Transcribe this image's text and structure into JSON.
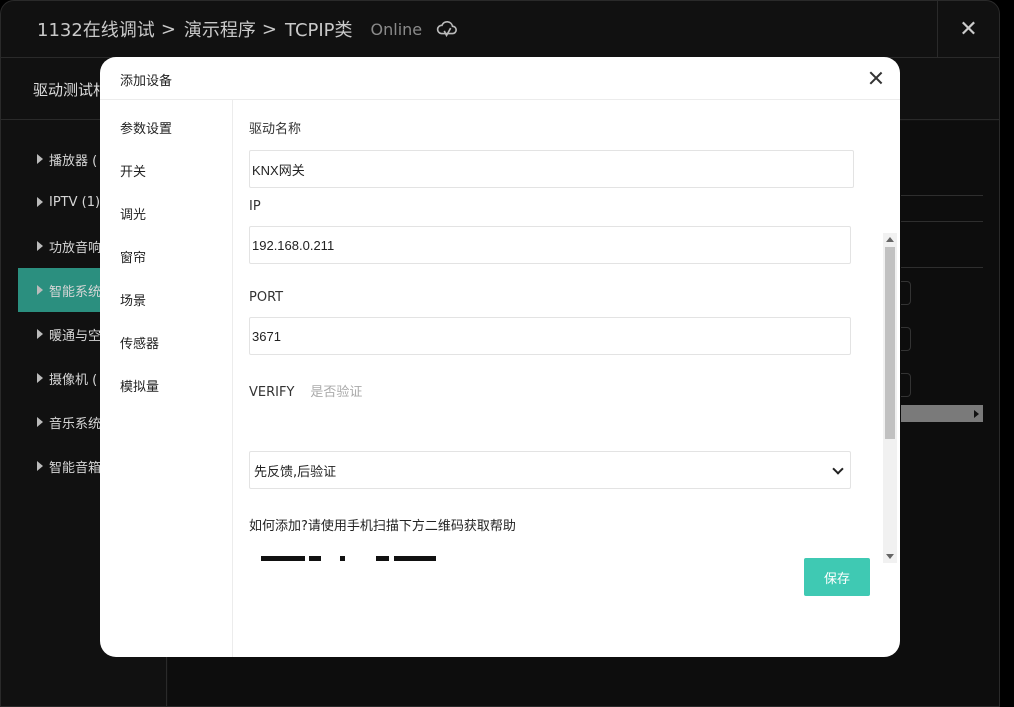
{
  "app": {
    "breadcrumbs": [
      "1132在线调试",
      "演示程序",
      "TCPIP类"
    ],
    "status": "Online",
    "sub_title": "驱动测试相",
    "sidebar": [
      {
        "label": "播放器 ("
      },
      {
        "label": "IPTV (1)"
      },
      {
        "label": "功放音响"
      },
      {
        "label": "智能系统"
      },
      {
        "label": "暖通与空"
      },
      {
        "label": "摄像机 ("
      },
      {
        "label": "音乐系统"
      },
      {
        "label": "智能音箱"
      }
    ],
    "close_glyph": "✕"
  },
  "modal": {
    "title": "添加设备",
    "nav": [
      "参数设置",
      "开关",
      "调光",
      "窗帘",
      "场景",
      "传感器",
      "模拟量"
    ],
    "form": {
      "driver_name_label": "驱动名称",
      "driver_name_value": "KNX网关",
      "ip_label": "IP",
      "ip_value": "192.168.0.211",
      "port_label": "PORT",
      "port_value": "3671",
      "verify_label": "VERIFY",
      "verify_hint": "是否验证",
      "verify_value": "先反馈,后验证",
      "help_text": "如何添加?请使用手机扫描下方二维码获取帮助"
    },
    "save_label": "保存"
  },
  "colors": {
    "accent": "#3fc9b3",
    "sidebar_active": "#2b8f7f",
    "background": "#111111"
  }
}
